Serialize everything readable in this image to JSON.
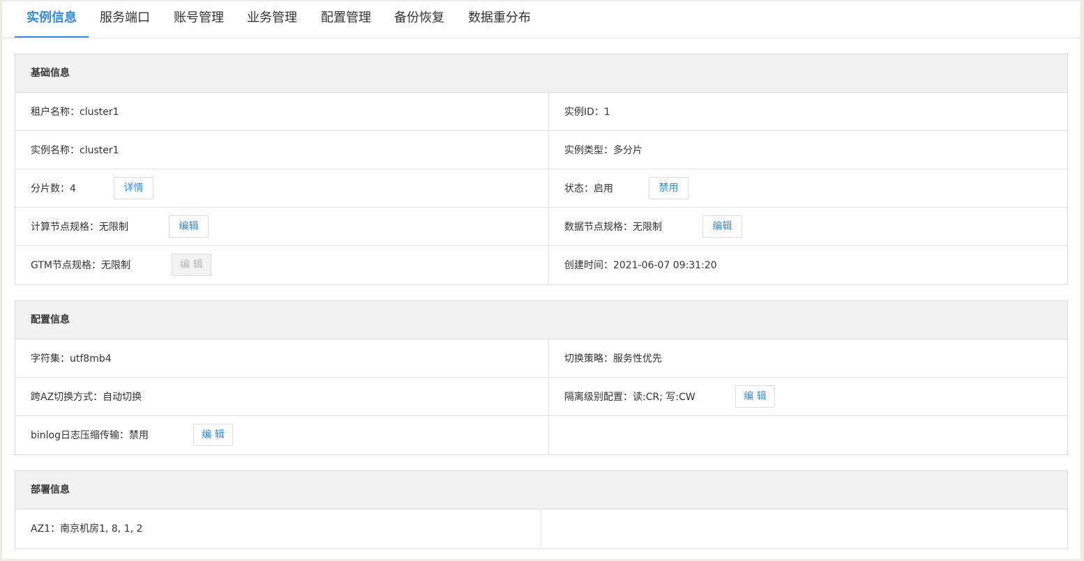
{
  "tabs": [
    {
      "label": "实例信息",
      "active": true
    },
    {
      "label": "服务端口",
      "active": false
    },
    {
      "label": "账号管理",
      "active": false
    },
    {
      "label": "业务管理",
      "active": false
    },
    {
      "label": "配置管理",
      "active": false
    },
    {
      "label": "备份恢复",
      "active": false
    },
    {
      "label": "数据重分布",
      "active": false
    }
  ],
  "basic": {
    "title": "基础信息",
    "tenant": "租户名称：cluster1",
    "instance_id": "实例ID：1",
    "instance_name": "实例名称：cluster1",
    "instance_type": "实例类型：多分片",
    "shards": "分片数：4",
    "shards_button": "详情",
    "status": "状态：启用",
    "status_button": "禁用",
    "compute_spec": "计算节点规格：无限制",
    "compute_button": "编辑",
    "data_spec": "数据节点规格：无限制",
    "data_button": "编辑",
    "gtm_spec": "GTM节点规格：无限制",
    "gtm_button": "编 辑",
    "created": "创建时间：2021-06-07 09:31:20"
  },
  "config": {
    "title": "配置信息",
    "charset": "字符集：utf8mb4",
    "switch_policy": "切换策略：服务性优先",
    "az_switch": "跨AZ切换方式：自动切换",
    "isolation": "隔离级别配置：读:CR; 写:CW",
    "isolation_button": "编 辑",
    "binlog": "binlog日志压缩传输：禁用",
    "binlog_button": "编 辑"
  },
  "deploy": {
    "title": "部署信息",
    "az1": "AZ1：南京机房1, 8, 1, 2"
  },
  "colors": {
    "accent": "#2d8cf0",
    "header_bg": "#f2f2f2",
    "border": "#dcdcdc"
  }
}
